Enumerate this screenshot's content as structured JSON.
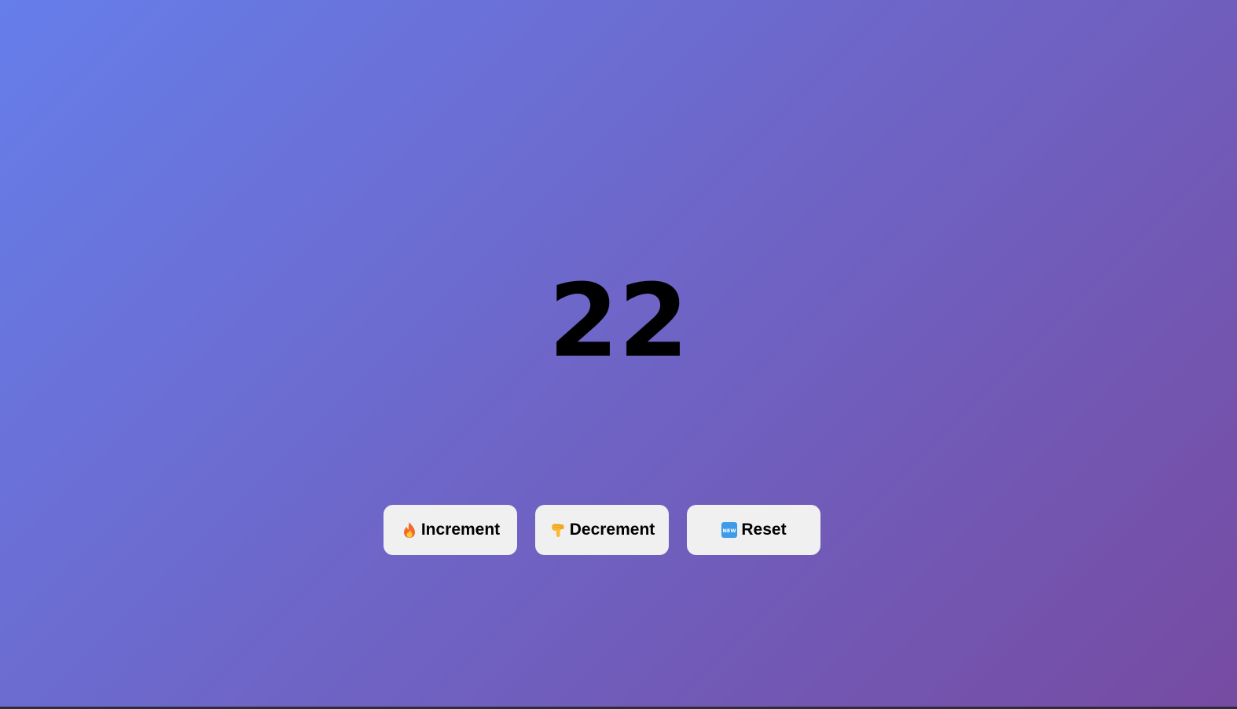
{
  "counter": {
    "value": "22"
  },
  "buttons": {
    "increment": {
      "label": "Increment",
      "icon": "fire-icon"
    },
    "decrement": {
      "label": "Decrement",
      "icon": "pointing-down-icon"
    },
    "reset": {
      "label": "Reset",
      "icon": "new-badge-icon",
      "badge_text": "NEW"
    }
  },
  "colors": {
    "gradient_start": "#667eea",
    "gradient_end": "#764ba2",
    "button_bg": "#f0f0f0",
    "text": "#000000"
  }
}
